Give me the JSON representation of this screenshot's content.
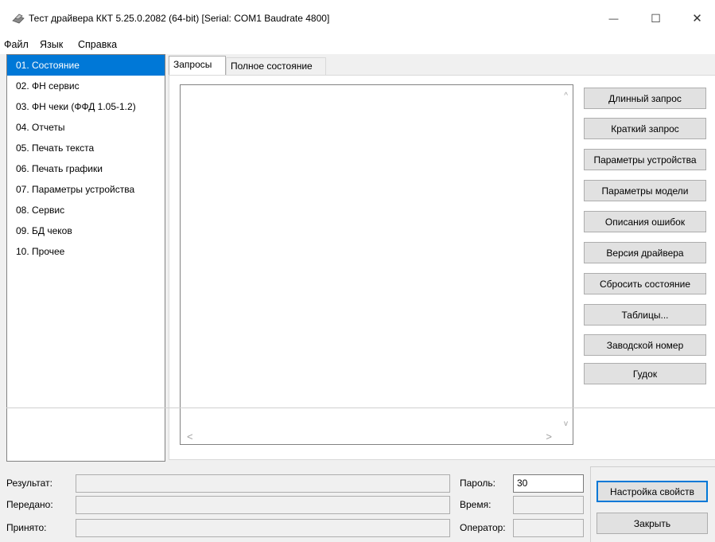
{
  "window": {
    "title": "Тест драйвера ККТ 5.25.0.2082 (64-bit) [Serial: COM1 Baudrate 4800]",
    "icon": "application-icon",
    "controls": {
      "minimize": "—",
      "maximize": "☐",
      "close": "✕"
    }
  },
  "menu": [
    "Файл",
    "Язык",
    "Справка"
  ],
  "sidebar": {
    "selected_index": 0,
    "items": [
      "01. Состояние",
      "02. ФН сервис",
      "03. ФН чеки (ФФД 1.05-1.2)",
      "04. Отчеты",
      "05. Печать текста",
      "06. Печать графики",
      "07. Параметры устройства",
      "08. Сервис",
      "09. БД чеков",
      "10. Прочее"
    ]
  },
  "tabs": {
    "active": "Запросы",
    "items": [
      "Запросы",
      "Полное состояние"
    ]
  },
  "output": {
    "text": "",
    "scroll_icons": {
      "up": "^",
      "down": "v",
      "left": "<",
      "right": ">"
    }
  },
  "commands": [
    "Длинный запрос",
    "Краткий запрос",
    "Параметры устройства",
    "Параметры модели",
    "Описания ошибок",
    "Версия драйвера",
    "Сбросить состояние",
    "Таблицы...",
    "Заводской номер",
    "Гудок"
  ],
  "status": {
    "result_label": "Результат:",
    "sent_label": "Передано:",
    "received_label": "Принято:",
    "password_label": "Пароль:",
    "password_value": "30",
    "time_label": "Время:",
    "operator_label": "Оператор:",
    "result_value": "",
    "sent_value": "",
    "received_value": "",
    "time_value": "",
    "operator_value": ""
  },
  "buttons": {
    "properties": "Настройка свойств",
    "close": "Закрыть"
  },
  "colors": {
    "selection": "#0078d7",
    "button_face": "#e1e1e1",
    "window_bg": "#f0f0f0"
  }
}
